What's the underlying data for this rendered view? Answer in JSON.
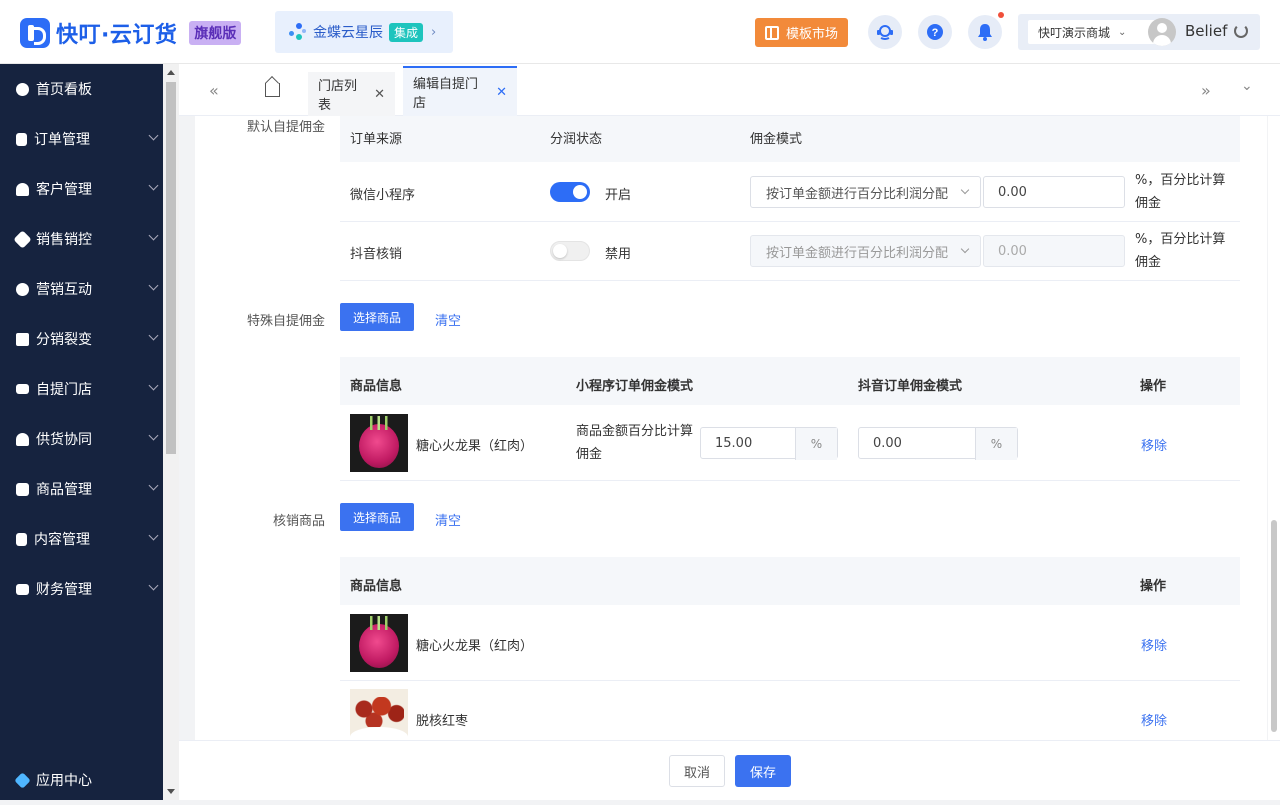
{
  "header": {
    "brand_name": "快叮·云订货",
    "edition_badge": "旗舰版",
    "kingdee_label": "金蝶云星辰",
    "kingdee_badge": "集成",
    "template_market": "模板市场",
    "store_name": "快叮演示商城",
    "username": "Belief",
    "accent_color": "#2d6df6"
  },
  "sidebar": {
    "items": [
      {
        "label": "首页看板"
      },
      {
        "label": "订单管理"
      },
      {
        "label": "客户管理"
      },
      {
        "label": "销售销控"
      },
      {
        "label": "营销互动"
      },
      {
        "label": "分销裂变"
      },
      {
        "label": "自提门店"
      },
      {
        "label": "供货协同"
      },
      {
        "label": "商品管理"
      },
      {
        "label": "内容管理"
      },
      {
        "label": "财务管理"
      }
    ],
    "bottom_item": "应用中心"
  },
  "tabs": [
    {
      "label": "门店列表"
    },
    {
      "label": "编辑自提门店"
    }
  ],
  "default_commission": {
    "label": "默认自提佣金",
    "headers": [
      "订单来源",
      "分润状态",
      "佣金模式"
    ],
    "rows": [
      {
        "source": "微信小程序",
        "status": "开启",
        "mode": "按订单金额进行百分比利润分配",
        "value": "0.00",
        "note": "%，百分比计算佣金"
      },
      {
        "source": "抖音核销",
        "status": "禁用",
        "mode": "按订单金额进行百分比利润分配",
        "value": "0.00",
        "note": "%，百分比计算佣金"
      }
    ]
  },
  "special_commission": {
    "label": "特殊自提佣金",
    "select_btn": "选择商品",
    "clear_link": "清空",
    "headers": [
      "商品信息",
      "小程序订单佣金模式",
      "抖音订单佣金模式",
      "操作"
    ],
    "rows": [
      {
        "name": "糖心火龙果（红肉）",
        "mode": "商品金额百分比计算佣金",
        "mini_value": "15.00",
        "douyin_value": "0.00",
        "unit": "%",
        "action": "移除"
      }
    ]
  },
  "verify_products": {
    "label": "核销商品",
    "select_btn": "选择商品",
    "clear_link": "清空",
    "headers": [
      "商品信息",
      "操作"
    ],
    "rows": [
      {
        "name": "糖心火龙果（红肉）",
        "action": "移除"
      },
      {
        "name": "脱核红枣",
        "action": "移除"
      }
    ]
  },
  "footer": {
    "cancel": "取消",
    "save": "保存"
  }
}
